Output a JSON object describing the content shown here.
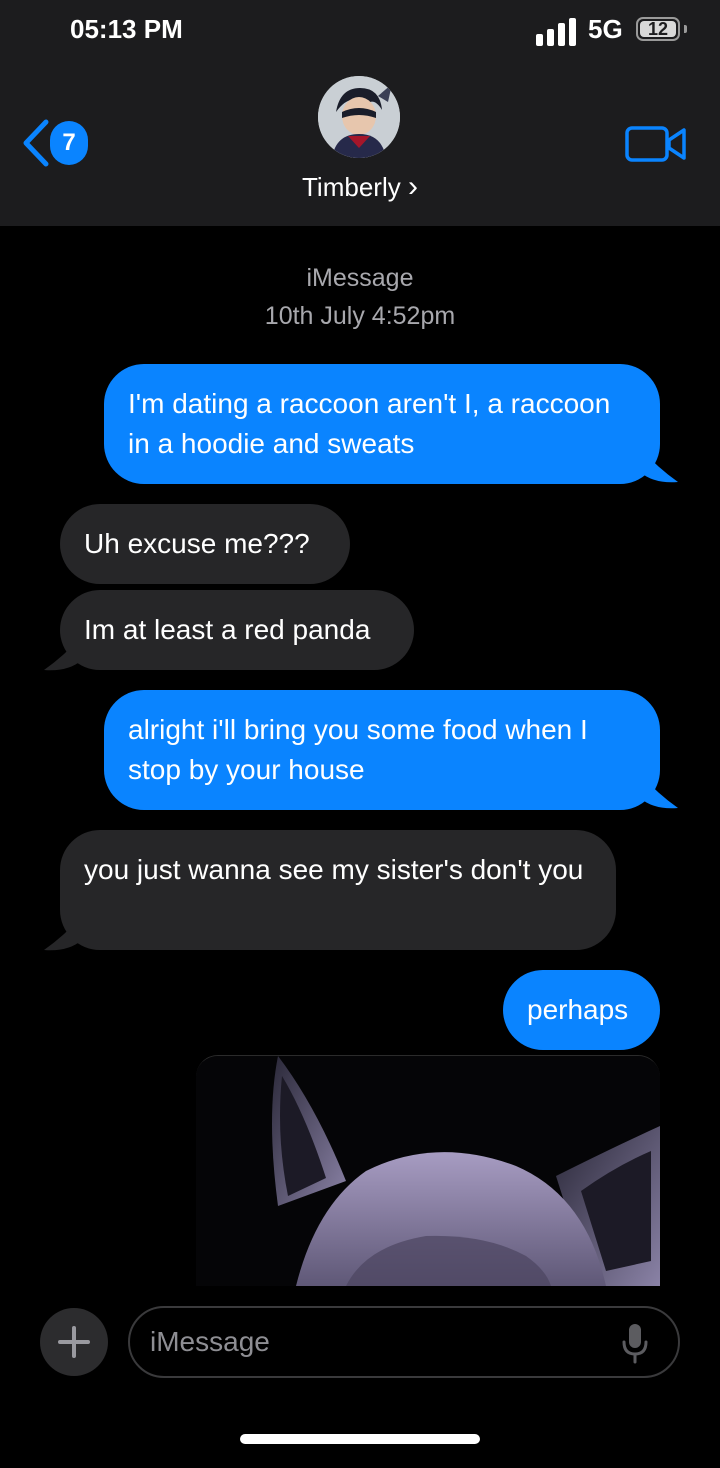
{
  "status_bar": {
    "time": "05:13 PM",
    "network": "5G",
    "battery": "12"
  },
  "header": {
    "back_count": "7",
    "contact_name": "Timberly",
    "name_chevron": "›"
  },
  "thread": {
    "service": "iMessage",
    "timestamp": "10th July 4:52pm",
    "messages": [
      {
        "from": "me",
        "text": "I'm dating a raccoon aren't I, a raccoon in a hoodie and sweats"
      },
      {
        "from": "them",
        "text": "Uh excuse me???"
      },
      {
        "from": "them",
        "text": "Im at least a red panda"
      },
      {
        "from": "me",
        "text": "alright i'll bring you some food when I stop by your house"
      },
      {
        "from": "them",
        "text": "you just wanna see my sister's don't you"
      },
      {
        "from": "me",
        "text": "perhaps"
      }
    ]
  },
  "composer": {
    "placeholder": "iMessage"
  },
  "colors": {
    "accent": "#0a84ff",
    "incoming_bubble": "#262628",
    "header_bg": "#1c1c1e"
  }
}
